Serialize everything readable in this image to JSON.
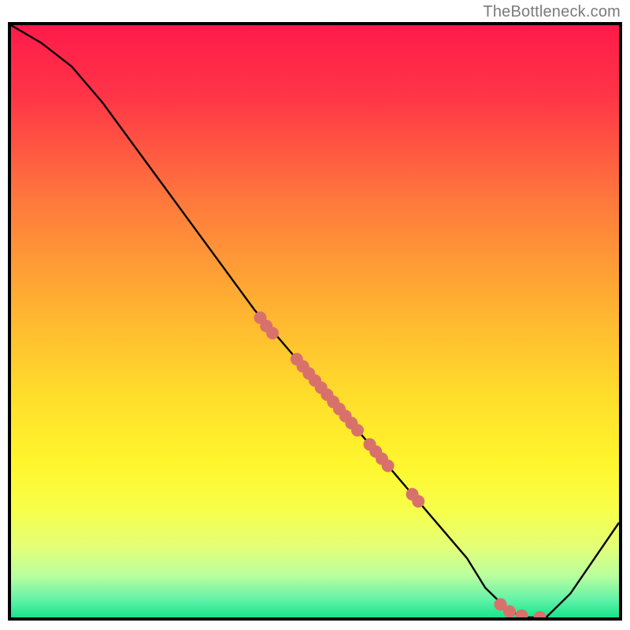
{
  "attribution": "TheBottleneck.com",
  "chart_data": {
    "type": "line",
    "title": "",
    "xlabel": "",
    "ylabel": "",
    "xlim": [
      0,
      100
    ],
    "ylim": [
      0,
      100
    ],
    "series": [
      {
        "name": "curve",
        "x": [
          0,
          5,
          10,
          15,
          20,
          25,
          30,
          35,
          40,
          45,
          50,
          55,
          60,
          65,
          70,
          75,
          78,
          80,
          82,
          85,
          88,
          92,
          96,
          100
        ],
        "y": [
          100,
          97,
          93,
          87,
          80,
          73,
          66,
          59,
          52,
          46,
          40,
          34,
          28,
          22,
          16,
          10,
          5,
          3,
          1,
          0,
          0,
          4,
          10,
          16
        ]
      }
    ],
    "scatter_points": {
      "name": "markers",
      "color": "#d9716b",
      "points": [
        {
          "x": 41,
          "y": 50.6
        },
        {
          "x": 42,
          "y": 49.2
        },
        {
          "x": 43,
          "y": 48.0
        },
        {
          "x": 47,
          "y": 43.6
        },
        {
          "x": 48,
          "y": 42.4
        },
        {
          "x": 49,
          "y": 41.2
        },
        {
          "x": 50,
          "y": 40.0
        },
        {
          "x": 51,
          "y": 38.8
        },
        {
          "x": 52,
          "y": 37.6
        },
        {
          "x": 53,
          "y": 36.4
        },
        {
          "x": 54,
          "y": 35.2
        },
        {
          "x": 55,
          "y": 34.0
        },
        {
          "x": 56,
          "y": 32.8
        },
        {
          "x": 57,
          "y": 31.6
        },
        {
          "x": 59,
          "y": 29.2
        },
        {
          "x": 60,
          "y": 28.0
        },
        {
          "x": 61,
          "y": 26.8
        },
        {
          "x": 62,
          "y": 25.6
        },
        {
          "x": 66,
          "y": 20.8
        },
        {
          "x": 67,
          "y": 19.6
        },
        {
          "x": 80.5,
          "y": 2.2
        },
        {
          "x": 82,
          "y": 1.0
        },
        {
          "x": 84,
          "y": 0.3
        },
        {
          "x": 87,
          "y": 0.0
        }
      ]
    },
    "gradient_stops": [
      {
        "offset": 0.0,
        "color": "#ff1a4a"
      },
      {
        "offset": 0.12,
        "color": "#ff3547"
      },
      {
        "offset": 0.3,
        "color": "#ff7a3c"
      },
      {
        "offset": 0.48,
        "color": "#ffb331"
      },
      {
        "offset": 0.62,
        "color": "#ffdc2b"
      },
      {
        "offset": 0.74,
        "color": "#fff62d"
      },
      {
        "offset": 0.82,
        "color": "#f7ff4a"
      },
      {
        "offset": 0.88,
        "color": "#e4ff77"
      },
      {
        "offset": 0.93,
        "color": "#b9ff9e"
      },
      {
        "offset": 0.97,
        "color": "#62f2a8"
      },
      {
        "offset": 1.0,
        "color": "#17e58b"
      }
    ]
  },
  "colors": {
    "frame": "#000000",
    "curve": "#000000",
    "marker": "#d9716b",
    "attribution": "#7a7a7a"
  }
}
